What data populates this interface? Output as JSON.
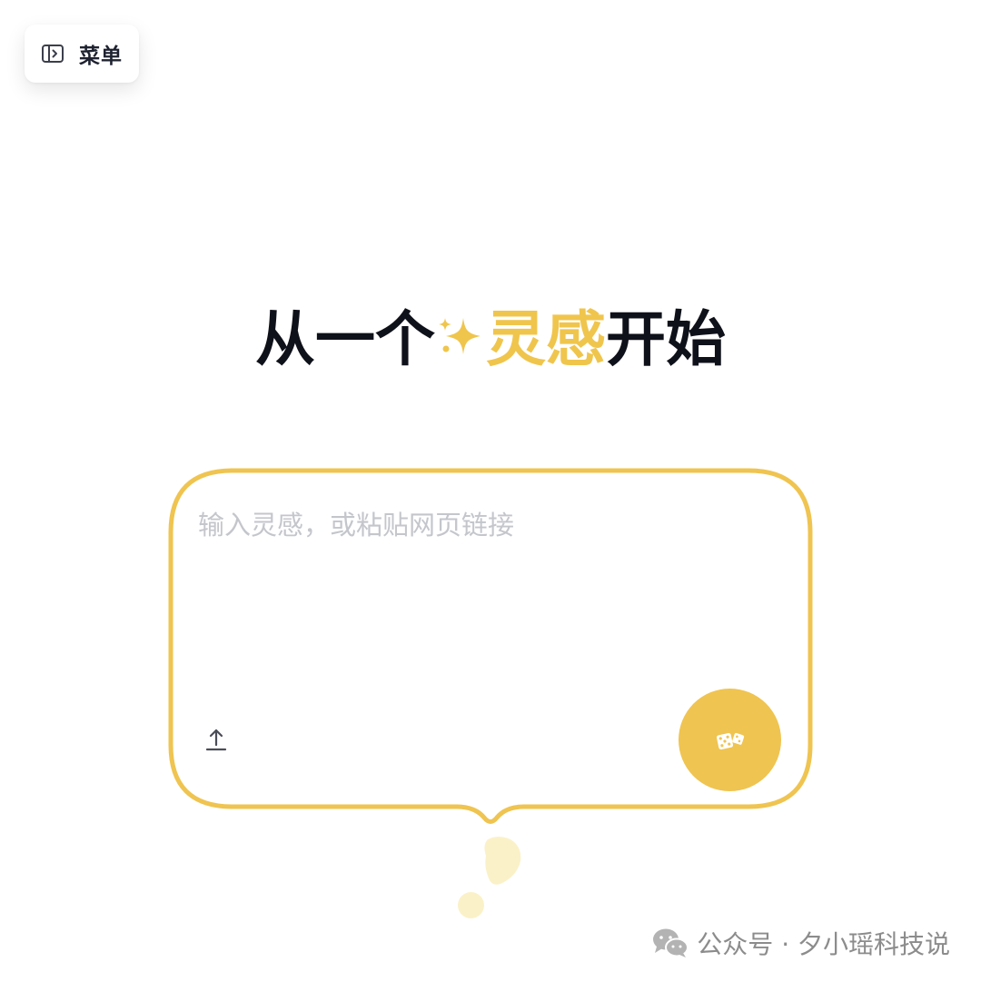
{
  "menu": {
    "label": "菜单",
    "icon": "sidebar-toggle-icon"
  },
  "hero": {
    "before": "从一个",
    "accent": "灵感",
    "after": "开始",
    "sparkle_icon": "sparkle-icon"
  },
  "prompt": {
    "placeholder": "输入灵感，或粘贴网页链接",
    "value": ""
  },
  "actions": {
    "upload_icon": "upload-icon",
    "random_icon": "dice-icon"
  },
  "watermark": {
    "text": "公众号 · 夕小瑶科技说",
    "icon": "wechat-icon"
  },
  "colors": {
    "accent": "#efc450",
    "accent_light": "#fbf1c8",
    "title": "#0f111a",
    "placeholder": "#c4c6cc",
    "watermark": "#8c8c8c"
  }
}
